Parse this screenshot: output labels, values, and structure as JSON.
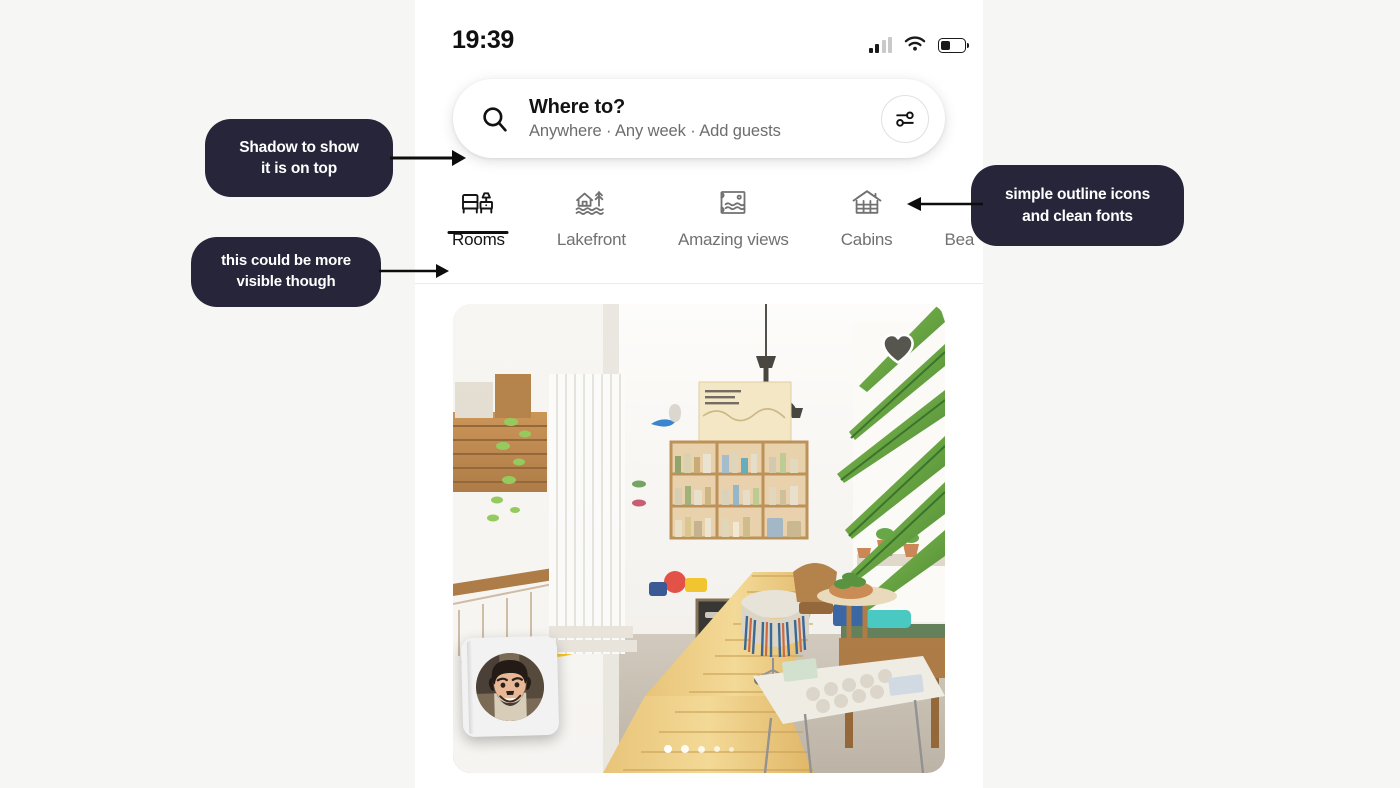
{
  "canvas": {
    "bg_color": "#f6f6f5",
    "accent_dark": "#262539"
  },
  "phone": {
    "status_bar": {
      "time": "19:39",
      "signal_icon": "cellular-signal-icon",
      "wifi_icon": "wifi-icon",
      "battery_icon": "battery-icon",
      "battery_level_pct": 42
    },
    "search": {
      "search_icon": "search-icon",
      "title": "Where to?",
      "subtitle": "Anywhere · Any week · Add guests",
      "placeholder": "Where to?",
      "filter_button_icon": "filter-sliders-icon"
    },
    "categories": {
      "active_index": 0,
      "items": [
        {
          "label": "Rooms",
          "icon": "bed-nightstand-icon",
          "active": true
        },
        {
          "label": "Lakefront",
          "icon": "house-lake-icon",
          "active": false
        },
        {
          "label": "Amazing views",
          "icon": "window-view-icon",
          "active": false
        },
        {
          "label": "Cabins",
          "icon": "log-cabin-icon",
          "active": false
        },
        {
          "label": "Bea",
          "icon": "beach-icon",
          "active": false
        }
      ]
    },
    "listing_card": {
      "photo_alt": "bright interior room with shelves, plants and bamboo floor",
      "favorite_icon": "heart-icon",
      "favorited": true,
      "host_avatar_icon": "host-avatar",
      "carousel": {
        "total_dots": 5,
        "active_dot": 1
      }
    }
  },
  "annotations": [
    {
      "id": "shadow-note",
      "line1": "Shadow to show",
      "line2": "it is on top"
    },
    {
      "id": "visibility-note",
      "line1": "this could be more",
      "line2": "visible though"
    },
    {
      "id": "icons-note",
      "line1": "simple outline icons",
      "line2": "and clean fonts"
    }
  ]
}
